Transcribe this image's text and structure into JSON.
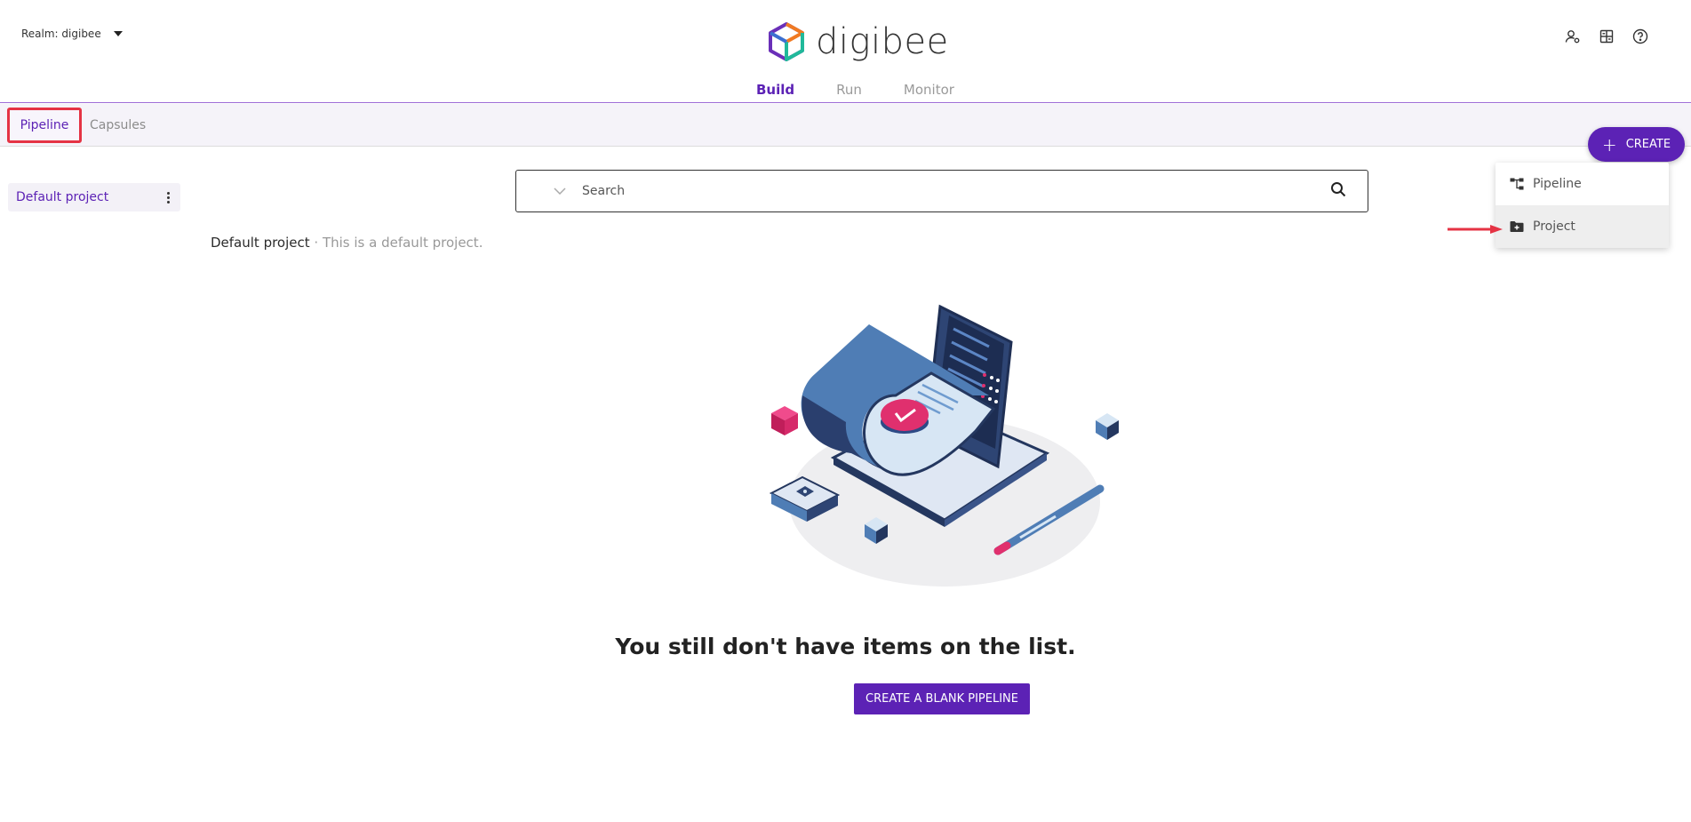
{
  "header": {
    "realm_label": "Realm: digibee",
    "logo_text": "digibee",
    "icons": [
      "user-settings-icon",
      "calculator-icon",
      "help-icon"
    ],
    "tabs": [
      {
        "label": "Build",
        "active": true
      },
      {
        "label": "Run",
        "active": false
      },
      {
        "label": "Monitor",
        "active": false
      }
    ]
  },
  "subnav": {
    "tabs": [
      {
        "label": "Pipeline",
        "active": true
      },
      {
        "label": "Capsules",
        "active": false
      }
    ]
  },
  "create_button": {
    "label": "CREATE"
  },
  "create_menu": {
    "items": [
      {
        "label": "Pipeline",
        "icon": "pipeline-icon"
      },
      {
        "label": "Project",
        "icon": "folder-plus-icon"
      }
    ]
  },
  "sidebar": {
    "projects": [
      {
        "label": "Default project"
      }
    ]
  },
  "search": {
    "placeholder": "Search"
  },
  "project_info": {
    "name": "Default project",
    "separator": " · ",
    "description": "This is a default project."
  },
  "empty_state": {
    "message": "You still don't have items on the list.",
    "button_label": "CREATE A BLANK PIPELINE"
  },
  "colors": {
    "brand": "#5c22b5",
    "highlight": "#e53344",
    "divider": "#9c6ad6"
  }
}
